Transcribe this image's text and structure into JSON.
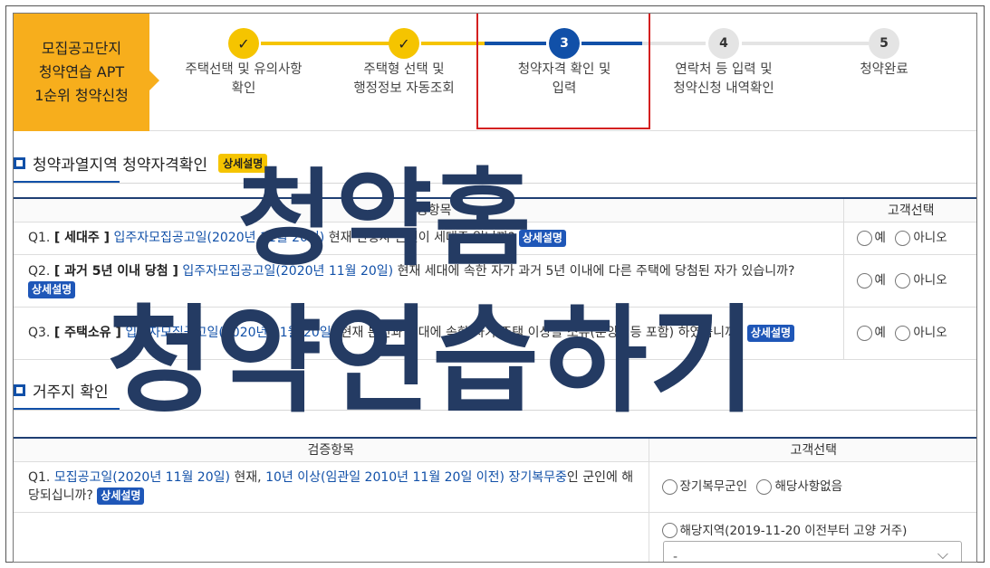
{
  "header": {
    "badge": [
      "모집공고단지",
      "청약연습 APT",
      "1순위 청약신청"
    ],
    "steps": [
      {
        "num": "✓",
        "state": "done",
        "label": [
          "주택선택 및 유의사항",
          "확인"
        ]
      },
      {
        "num": "✓",
        "state": "done",
        "label": [
          "주택형 선택 및",
          "행정정보 자동조회"
        ]
      },
      {
        "num": "3",
        "state": "active",
        "label": [
          "청약자격 확인 및",
          "입력"
        ]
      },
      {
        "num": "4",
        "state": "todo",
        "label": [
          "연락처 등 입력 및",
          "청약신청 내역확인"
        ]
      },
      {
        "num": "5",
        "state": "todo",
        "label": [
          "청약완료",
          ""
        ]
      }
    ]
  },
  "section1": {
    "title": "청약과열지역 청약자격확인",
    "detail_pill": "상세설명",
    "col_item": "검증항목",
    "col_choice": "고객선택",
    "questions": [
      {
        "no": "Q1.",
        "tag": "[ 세대주 ]",
        "date": "입주자모집공고일(2020년 11월 20일)",
        "text": " 현재 신청자 본인이 세대주 입니까?",
        "detail": "상세설명"
      },
      {
        "no": "Q2.",
        "tag": "[ 과거 5년 이내 당첨 ]",
        "date": "입주자모집공고일(2020년 11월 20일)",
        "text": " 현재 세대에 속한 자가 과거 5년 이내에 다른 주택에 당첨된 자가 있습니까?",
        "detail": "상세설명"
      },
      {
        "no": "Q3.",
        "tag": "[ 주택소유 ]",
        "date": "입주자모집공고일(2020년 11월 20일)",
        "text": " 현재 본인과 세대에 속한 자가 주택 이상을 소유(분양권등 포함) 하였습니까?",
        "detail": "상세설명"
      }
    ],
    "yes": "예",
    "no": "아니오"
  },
  "section2": {
    "title": "거주지 확인",
    "col_item": "검증항목",
    "col_choice": "고객선택",
    "q1": {
      "no": "Q1.",
      "date": "모집공고일(2020년 11월 20일)",
      "mid": " 현재, ",
      "period": "10년 이상(임관일 2010년 11월 20일 이전)",
      "sp": " ",
      "military": "장기복무중",
      "tail": "인 군인에 해당되십니까?",
      "detail": "상세설명"
    },
    "opt_military": "장기복무군인",
    "opt_none": "해당사항없음",
    "opt_region": "해당지역(2019-11-20 이전부터 고양 거주)",
    "select_value": "-"
  },
  "watermark": {
    "line1": "청약홈",
    "line2": "청약연습하기"
  },
  "colors": {
    "accent_yellow": "#f5c400",
    "badge_orange": "#f7ae1c",
    "primary_blue": "#1150a8",
    "highlight_red": "#d42020",
    "watermark_navy": "#243b63"
  }
}
